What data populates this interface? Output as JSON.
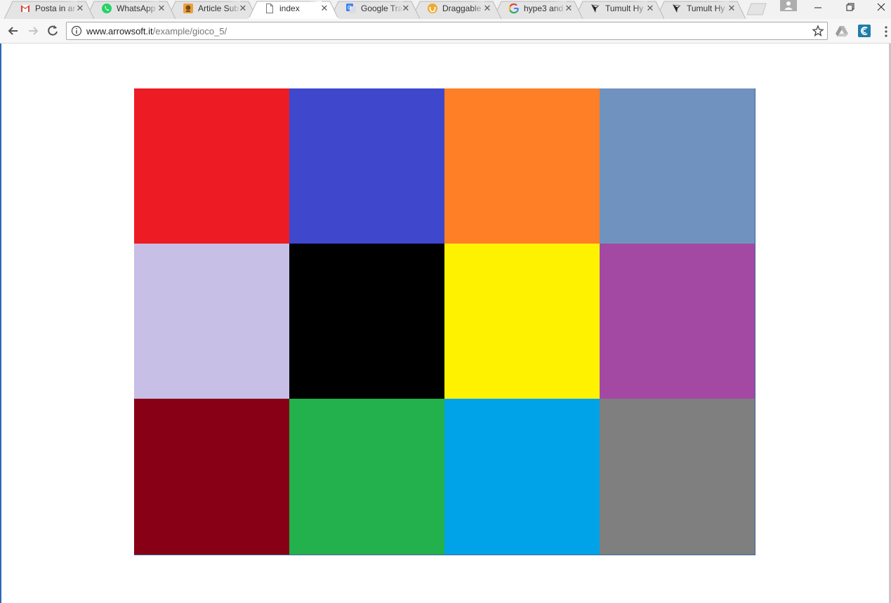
{
  "browser": {
    "tabs": [
      {
        "label": "Posta in ar",
        "icon": "gmail-icon",
        "active": false
      },
      {
        "label": "WhatsApp",
        "icon": "whatsapp-icon",
        "active": false
      },
      {
        "label": "Article Sub",
        "icon": "article-icon",
        "active": false
      },
      {
        "label": "index",
        "icon": "page-icon",
        "active": true
      },
      {
        "label": "Google Tra",
        "icon": "google-translate-icon",
        "active": false
      },
      {
        "label": "Draggable",
        "icon": "draggable-icon",
        "active": false
      },
      {
        "label": "hype3 and",
        "icon": "google-icon",
        "active": false
      },
      {
        "label": "Tumult Hy",
        "icon": "tumult-icon",
        "active": false
      },
      {
        "label": "Tumult Hy",
        "icon": "tumult-icon",
        "active": false
      }
    ],
    "close_glyph": "✕",
    "address": {
      "host": "www.arrowsoft.it",
      "path": "/example/gioco_5/"
    },
    "window_controls": [
      "minimize-icon",
      "restore-icon",
      "close-icon"
    ]
  },
  "page": {
    "colors": [
      {
        "name": "red",
        "hex": "#ed1c24"
      },
      {
        "name": "blue",
        "hex": "#3f48cc"
      },
      {
        "name": "orange",
        "hex": "#ff7f27"
      },
      {
        "name": "steel-blue",
        "hex": "#7092be"
      },
      {
        "name": "lavender",
        "hex": "#c8bfe7"
      },
      {
        "name": "black",
        "hex": "#000000"
      },
      {
        "name": "yellow",
        "hex": "#fff200"
      },
      {
        "name": "purple",
        "hex": "#a349a4"
      },
      {
        "name": "maroon",
        "hex": "#880015"
      },
      {
        "name": "green",
        "hex": "#22b14c"
      },
      {
        "name": "sky-blue",
        "hex": "#00a2e8"
      },
      {
        "name": "gray",
        "hex": "#7f7f7f"
      }
    ]
  }
}
